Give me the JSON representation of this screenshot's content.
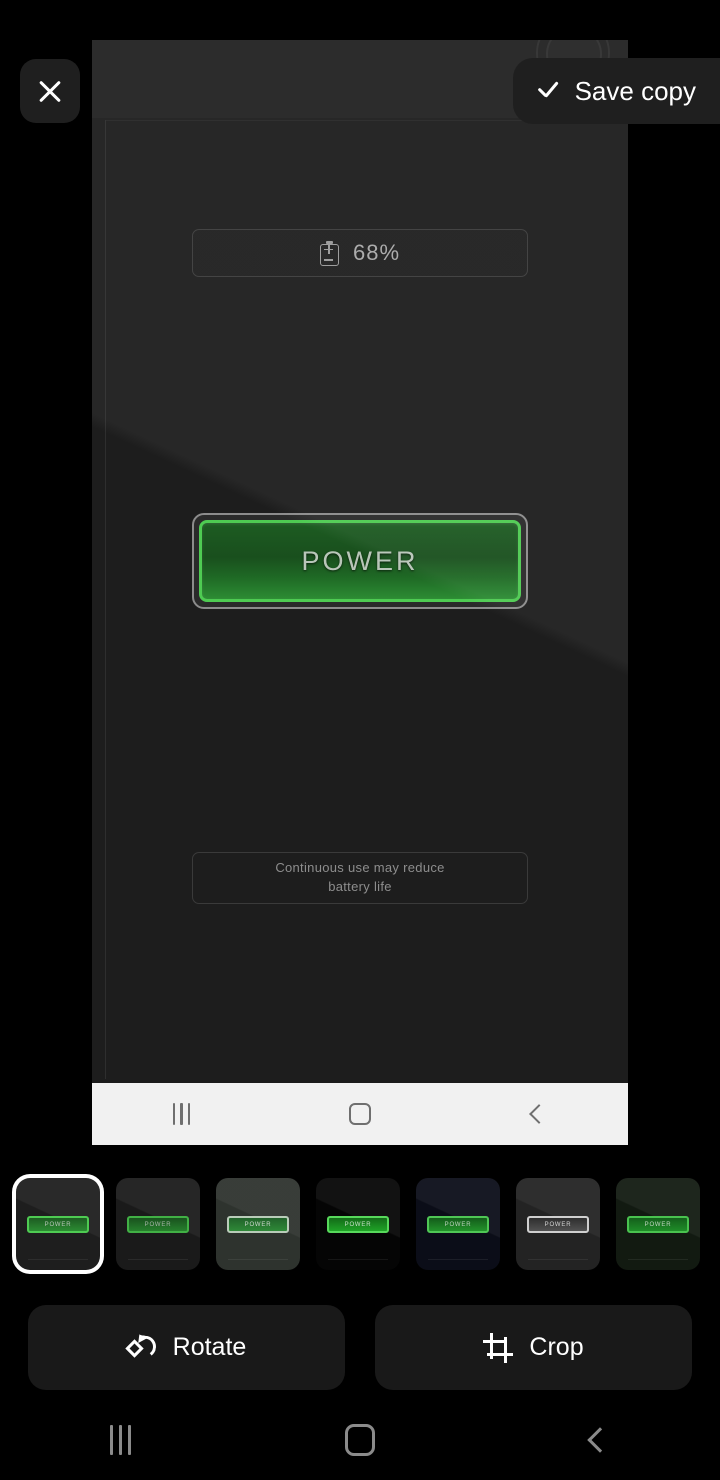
{
  "overlay": {
    "close_label": "×",
    "close_icon": "close-icon",
    "save_label": "Save copy",
    "save_icon": "check-icon",
    "kebab_icon": "more-vertical-icon"
  },
  "screenshot_content": {
    "battery": {
      "icon": "battery-icon",
      "percent": "68%"
    },
    "power_button": {
      "label": "POWER",
      "border_color": "#4ecb52",
      "fill_gradient_top": "#1d5c22",
      "fill_gradient_bottom": "#2c8c33",
      "frame_color": "#8c8c8c"
    },
    "warning": {
      "line1": "Continuous use may reduce",
      "line2": "battery life"
    },
    "inner_nav": {
      "recents_icon": "recents-icon",
      "home_icon": "home-icon",
      "back_icon": "back-icon"
    }
  },
  "filters": {
    "items": [
      {
        "name": "original",
        "selected": true,
        "bg": "#1e1e1e",
        "btn_bg": "linear-gradient(180deg,#1d5c22,#2c8c33)",
        "btn_border": "#4ecb52",
        "txt": "POWER",
        "txt_color": "#b9c6b9"
      },
      {
        "name": "dim",
        "selected": false,
        "bg": "#1a1a1a",
        "btn_bg": "linear-gradient(180deg,#19521e,#27802d)",
        "btn_border": "#41b045",
        "txt": "POWER",
        "txt_color": "#a8b4a8"
      },
      {
        "name": "faded",
        "selected": false,
        "bg": "#2e332e",
        "btn_bg": "linear-gradient(180deg,#21622a,#2f8a38)",
        "btn_border": "#b9ccb9",
        "txt": "POWER",
        "txt_color": "#cfd8cf"
      },
      {
        "name": "contrast",
        "selected": false,
        "bg": "#050505",
        "btn_bg": "linear-gradient(180deg,#136b18,#1fa327)",
        "btn_border": "#57d95b",
        "txt": "POWER",
        "txt_color": "#c9e0c9"
      },
      {
        "name": "cool",
        "selected": false,
        "bg": "#0b0d18",
        "btn_bg": "linear-gradient(180deg,#135c1a,#23922b)",
        "btn_border": "#4fc655",
        "txt": "POWER",
        "txt_color": "#bed2be"
      },
      {
        "name": "mono",
        "selected": false,
        "bg": "#232323",
        "btn_bg": "linear-gradient(180deg,#2e2e2e,#525252)",
        "btn_border": "#cfcfcf",
        "txt": "POWER",
        "txt_color": "#d5d5d5"
      },
      {
        "name": "verdant",
        "selected": false,
        "bg": "#121a11",
        "btn_bg": "linear-gradient(180deg,#14601b,#1f8d28)",
        "btn_border": "#49c24f",
        "txt": "POWER",
        "txt_color": "#c2d6c2"
      }
    ]
  },
  "tools": {
    "rotate_label": "Rotate",
    "rotate_icon": "rotate-icon",
    "crop_label": "Crop",
    "crop_icon": "crop-icon"
  },
  "system_nav": {
    "recents_icon": "recents-icon",
    "home_icon": "home-icon",
    "back_icon": "back-icon"
  }
}
